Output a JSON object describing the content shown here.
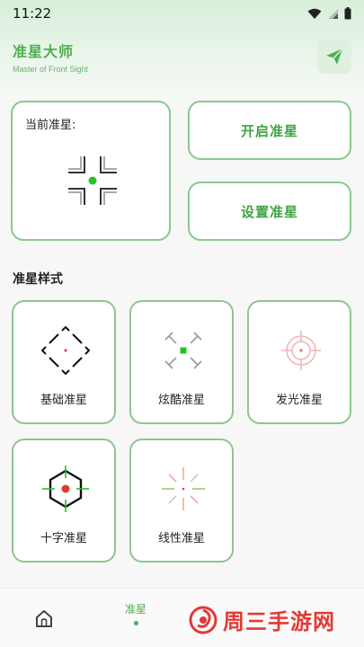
{
  "status": {
    "time": "11:22"
  },
  "header": {
    "title": "准星大师",
    "subtitle": "Master of Front Sight"
  },
  "current": {
    "label": "当前准星:"
  },
  "actions": {
    "open_label": "开启准星",
    "settings_label": "设置准星"
  },
  "section": {
    "title": "准星样式"
  },
  "styles": [
    {
      "label": "基础准星",
      "icon": "basic-crosshair-icon"
    },
    {
      "label": "炫酷准星",
      "icon": "cool-crosshair-icon"
    },
    {
      "label": "发光准星",
      "icon": "glow-crosshair-icon"
    },
    {
      "label": "十字准星",
      "icon": "cross-crosshair-icon"
    },
    {
      "label": "线性准星",
      "icon": "linear-crosshair-icon"
    }
  ],
  "nav": {
    "active_label": "准星"
  },
  "watermark": {
    "text": "周三手游网"
  },
  "colors": {
    "accent": "#4caf50",
    "border": "#8cc78d",
    "watermark": "#e53935"
  }
}
